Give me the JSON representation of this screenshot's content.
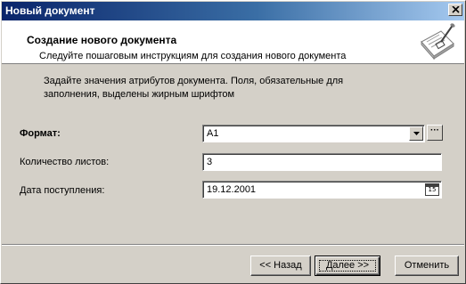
{
  "window": {
    "title": "Новый документ"
  },
  "header": {
    "title": "Создание нового документа",
    "subtitle": "Следуйте пошаговым инструкциям для создания нового документа"
  },
  "info": {
    "line1": "Задайте значения атрибутов документа. Поля, обязательные для",
    "line2": "заполнения, выделены жирным шрифтом"
  },
  "form": {
    "format": {
      "label": "Формат:",
      "value": "A1"
    },
    "sheets": {
      "label": "Количество листов:",
      "value": "3"
    },
    "received": {
      "label": "Дата поступления:",
      "value": "19.12.2001",
      "calendar_glyph": "15"
    }
  },
  "buttons": {
    "back": "<< Назад",
    "next": "Далее >>",
    "cancel": "Отменить"
  },
  "colors": {
    "titlebar_start": "#0a246a",
    "titlebar_end": "#a6caf0",
    "dialog_face": "#d4d0c8"
  }
}
